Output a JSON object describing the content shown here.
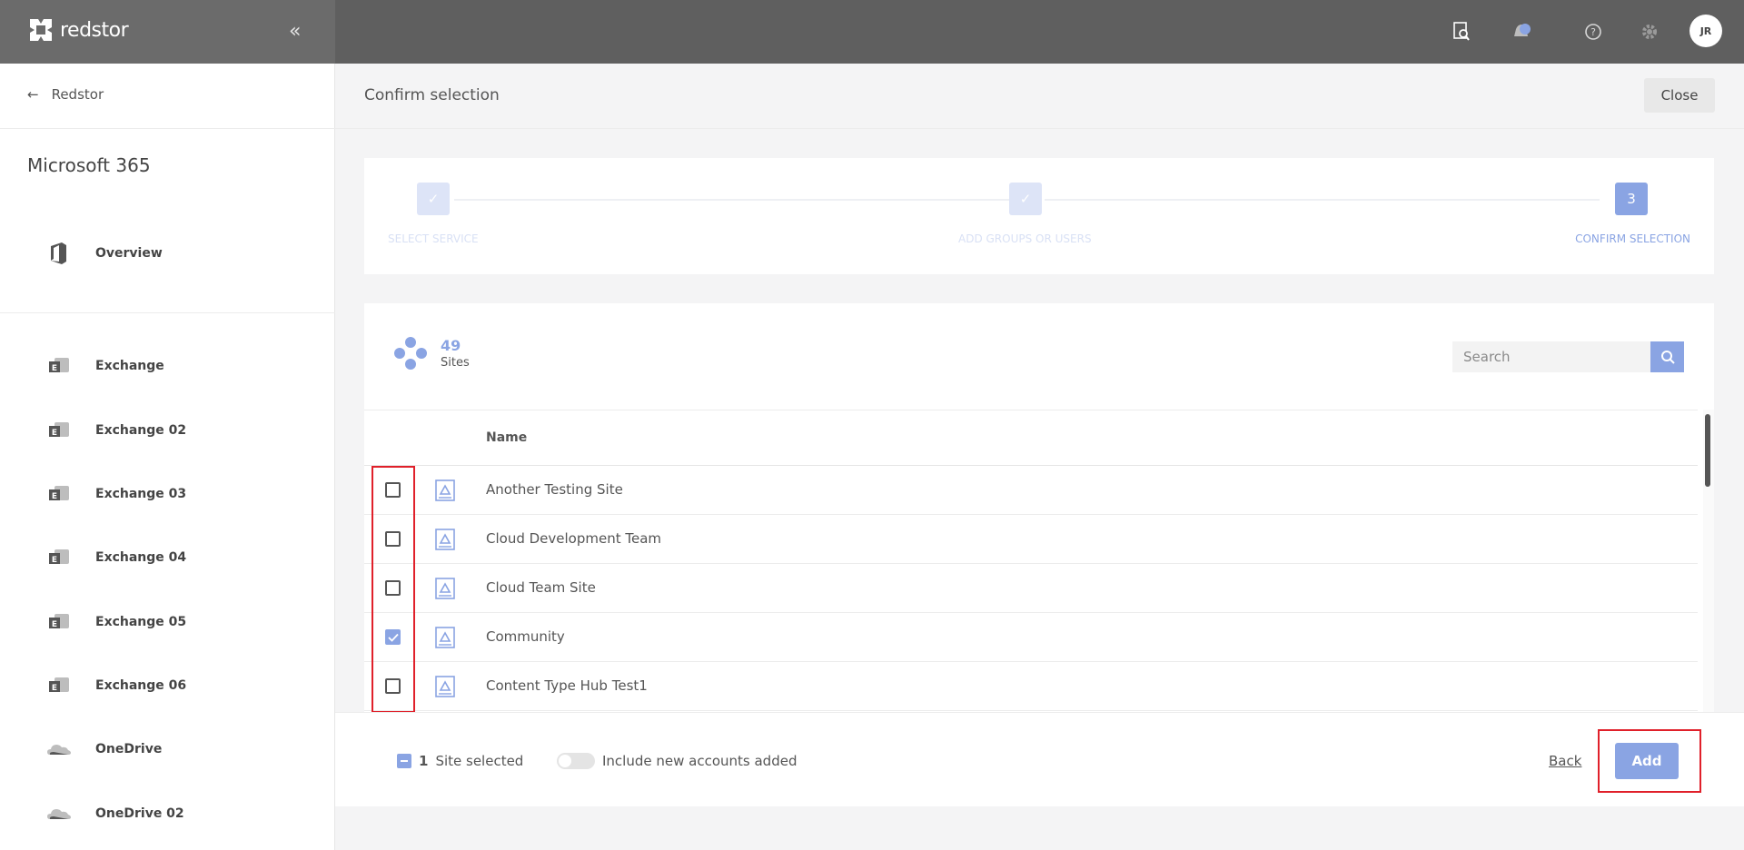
{
  "app": {
    "brand": "redstor",
    "avatar_initials": "JR"
  },
  "sidebar": {
    "back_label": "Redstor",
    "title": "Microsoft 365",
    "overview_label": "Overview",
    "items": [
      {
        "label": "Exchange",
        "icon": "exchange-icon"
      },
      {
        "label": "Exchange 02",
        "icon": "exchange-icon"
      },
      {
        "label": "Exchange 03",
        "icon": "exchange-icon"
      },
      {
        "label": "Exchange 04",
        "icon": "exchange-icon"
      },
      {
        "label": "Exchange 05",
        "icon": "exchange-icon"
      },
      {
        "label": "Exchange 06",
        "icon": "exchange-icon"
      },
      {
        "label": "OneDrive",
        "icon": "onedrive-icon"
      },
      {
        "label": "OneDrive 02",
        "icon": "onedrive-icon"
      }
    ]
  },
  "header": {
    "title": "Confirm selection",
    "close_label": "Close"
  },
  "stepper": {
    "steps": [
      {
        "label": "SELECT SERVICE",
        "state": "done",
        "marker": "✓"
      },
      {
        "label": "ADD GROUPS OR USERS",
        "state": "done",
        "marker": "✓"
      },
      {
        "label": "CONFIRM SELECTION",
        "state": "active",
        "marker": "3"
      }
    ]
  },
  "sites": {
    "count": "49",
    "label": "Sites",
    "search_placeholder": "Search",
    "column_name": "Name",
    "rows": [
      {
        "name": "Another Testing Site",
        "checked": false
      },
      {
        "name": "Cloud Development Team",
        "checked": false
      },
      {
        "name": "Cloud Team Site",
        "checked": false
      },
      {
        "name": "Community",
        "checked": true
      },
      {
        "name": "Content Type Hub Test1",
        "checked": false
      }
    ]
  },
  "footer": {
    "selected_count": "1",
    "selected_text": "Site selected",
    "toggle_label": "Include new accounts added",
    "back_label": "Back",
    "add_label": "Add"
  },
  "colors": {
    "accent": "#8aa4e3",
    "topbar": "#5f5f5f",
    "highlight": "#e0202a"
  }
}
